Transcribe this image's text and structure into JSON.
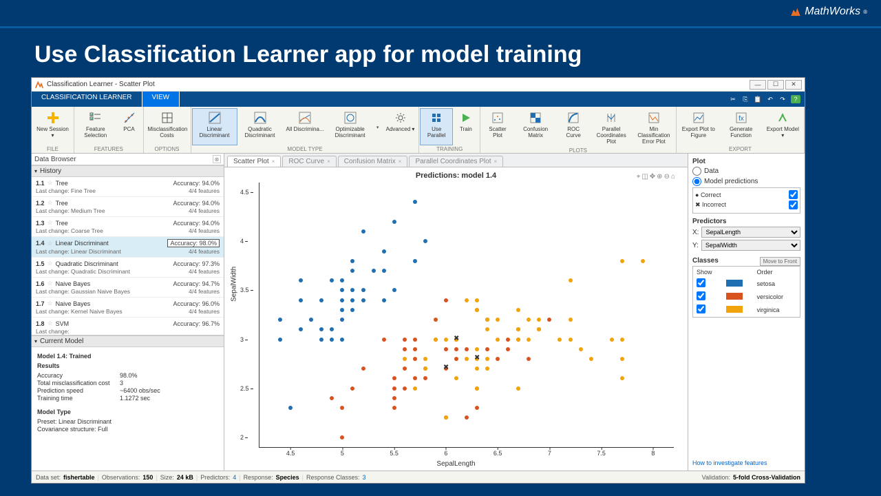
{
  "slide": {
    "brand": "MathWorks",
    "title": "Use Classification Learner app for model training"
  },
  "window": {
    "title": "Classification Learner - Scatter Plot"
  },
  "app_tabs": {
    "active": "CLASSIFICATION LEARNER",
    "other": "VIEW"
  },
  "toolstrip": {
    "file": {
      "label": "FILE",
      "btns": [
        {
          "k": "new",
          "l": "New Session ▾"
        }
      ]
    },
    "features": {
      "label": "FEATURES",
      "btns": [
        {
          "k": "fs",
          "l": "Feature Selection"
        },
        {
          "k": "pca",
          "l": "PCA"
        }
      ]
    },
    "options": {
      "label": "OPTIONS",
      "btns": [
        {
          "k": "mc",
          "l": "Misclassification Costs"
        }
      ]
    },
    "modeltype": {
      "label": "MODEL TYPE",
      "btns": [
        {
          "k": "ld",
          "l": "Linear Discriminant",
          "sel": true
        },
        {
          "k": "qd",
          "l": "Quadratic Discriminant"
        },
        {
          "k": "ad",
          "l": "All Discrimina..."
        },
        {
          "k": "od",
          "l": "Optimizable Discriminant"
        }
      ],
      "dd": true,
      "adv": {
        "k": "adv",
        "l": "Advanced ▾"
      }
    },
    "training": {
      "label": "TRAINING",
      "btns": [
        {
          "k": "up",
          "l": "Use Parallel",
          "sel": true
        },
        {
          "k": "tr",
          "l": "Train"
        }
      ]
    },
    "plots": {
      "label": "PLOTS",
      "btns": [
        {
          "k": "sp",
          "l": "Scatter Plot"
        },
        {
          "k": "cm",
          "l": "Confusion Matrix"
        },
        {
          "k": "rc",
          "l": "ROC Curve"
        },
        {
          "k": "pc",
          "l": "Parallel Coordinates Plot"
        },
        {
          "k": "mce",
          "l": "Min Classification Error Plot"
        }
      ]
    },
    "export": {
      "label": "EXPORT",
      "btns": [
        {
          "k": "ef",
          "l": "Export Plot to Figure"
        },
        {
          "k": "gf",
          "l": "Generate Function"
        },
        {
          "k": "em",
          "l": "Export Model ▾"
        }
      ]
    }
  },
  "data_browser": "Data Browser",
  "history": {
    "label": "History",
    "items": [
      {
        "id": "1.1",
        "name": "Tree",
        "acc": "94.0%",
        "feat": "4/4 features",
        "last": "Fine Tree"
      },
      {
        "id": "1.2",
        "name": "Tree",
        "acc": "94.0%",
        "feat": "4/4 features",
        "last": "Medium Tree"
      },
      {
        "id": "1.3",
        "name": "Tree",
        "acc": "94.0%",
        "feat": "4/4 features",
        "last": "Coarse Tree"
      },
      {
        "id": "1.4",
        "name": "Linear Discriminant",
        "acc": "98.0%",
        "feat": "4/4 features",
        "last": "Linear Discriminant",
        "active": true
      },
      {
        "id": "1.5",
        "name": "Quadratic Discriminant",
        "acc": "97.3%",
        "feat": "4/4 features",
        "last": "Quadratic Discriminant"
      },
      {
        "id": "1.6",
        "name": "Naive Bayes",
        "acc": "94.7%",
        "feat": "4/4 features",
        "last": "Gaussian Naive Bayes"
      },
      {
        "id": "1.7",
        "name": "Naive Bayes",
        "acc": "96.0%",
        "feat": "4/4 features",
        "last": "Kernel Naive Bayes"
      },
      {
        "id": "1.8",
        "name": "SVM",
        "acc": "96.7%",
        "feat": "",
        "last": ""
      }
    ],
    "acc_label": "Accuracy:",
    "last_label": "Last change:"
  },
  "current_model": {
    "label": "Current Model",
    "heading": "Model 1.4: Trained",
    "results_h": "Results",
    "rows": [
      {
        "k": "Accuracy",
        "v": "98.0%"
      },
      {
        "k": "Total misclassification cost",
        "v": "3"
      },
      {
        "k": "Prediction speed",
        "v": "~6400 obs/sec"
      },
      {
        "k": "Training time",
        "v": "1.1272 sec"
      }
    ],
    "mt_h": "Model Type",
    "mt_rows": [
      {
        "k": "Preset:",
        "v": "Linear Discriminant"
      },
      {
        "k": "Covariance structure:",
        "v": "Full"
      }
    ]
  },
  "doc_tabs": [
    "Scatter Plot",
    "ROC Curve",
    "Confusion Matrix",
    "Parallel Coordinates Plot"
  ],
  "plot": {
    "title": "Predictions: model 1.4",
    "xlabel": "SepalLength",
    "ylabel": "SepalWidth",
    "right": {
      "plot_h": "Plot",
      "data": "Data",
      "mp": "Model predictions",
      "correct": "Correct",
      "incorrect": "Incorrect",
      "pred_h": "Predictors",
      "x": "X:",
      "y": "Y:",
      "xsel": "SepalLength",
      "ysel": "SepalWidth",
      "cls_h": "Classes",
      "move": "Move to Front",
      "show": "Show",
      "order": "Order",
      "c1": "setosa",
      "c2": "versicolor",
      "c3": "virginica",
      "link": "How to investigate features"
    }
  },
  "status": {
    "dataset_k": "Data set:",
    "dataset_v": "fishertable",
    "obs_k": "Observations:",
    "obs_v": "150",
    "size_k": "Size:",
    "size_v": "24 kB",
    "pred_k": "Predictors:",
    "pred_v": "4",
    "resp_k": "Response:",
    "resp_v": "Species",
    "rc_k": "Response Classes:",
    "rc_v": "3",
    "val_k": "Validation:",
    "val_v": "5-fold Cross-Validation"
  },
  "chart_data": {
    "type": "scatter",
    "title": "Predictions: model 1.4",
    "xlabel": "SepalLength",
    "ylabel": "SepalWidth",
    "xlim": [
      4.2,
      8.2
    ],
    "ylim": [
      1.9,
      4.6
    ],
    "xticks": [
      4.5,
      5,
      5.5,
      6,
      6.5,
      7,
      7.5,
      8
    ],
    "yticks": [
      2,
      2.5,
      3,
      3.5,
      4,
      4.5
    ],
    "classes": [
      "setosa",
      "versicolor",
      "virginica"
    ],
    "colors": {
      "setosa": "#1f6fb2",
      "versicolor": "#d9531e",
      "virginica": "#f0a30a"
    },
    "series": [
      {
        "name": "setosa",
        "points": [
          [
            4.4,
            3.0
          ],
          [
            4.4,
            3.2
          ],
          [
            4.5,
            2.3
          ],
          [
            4.6,
            3.1
          ],
          [
            4.6,
            3.4
          ],
          [
            4.6,
            3.6
          ],
          [
            4.7,
            3.2
          ],
          [
            4.8,
            3.0
          ],
          [
            4.8,
            3.1
          ],
          [
            4.8,
            3.4
          ],
          [
            4.9,
            3.0
          ],
          [
            4.9,
            3.1
          ],
          [
            4.9,
            3.6
          ],
          [
            5.0,
            3.0
          ],
          [
            5.0,
            3.2
          ],
          [
            5.0,
            3.3
          ],
          [
            5.0,
            3.4
          ],
          [
            5.0,
            3.5
          ],
          [
            5.0,
            3.6
          ],
          [
            5.1,
            3.3
          ],
          [
            5.1,
            3.4
          ],
          [
            5.1,
            3.5
          ],
          [
            5.1,
            3.7
          ],
          [
            5.1,
            3.8
          ],
          [
            5.2,
            3.4
          ],
          [
            5.2,
            3.5
          ],
          [
            5.2,
            4.1
          ],
          [
            5.3,
            3.7
          ],
          [
            5.4,
            3.4
          ],
          [
            5.4,
            3.7
          ],
          [
            5.4,
            3.9
          ],
          [
            5.5,
            3.5
          ],
          [
            5.5,
            4.2
          ],
          [
            5.7,
            3.8
          ],
          [
            5.7,
            4.4
          ],
          [
            5.8,
            4.0
          ]
        ]
      },
      {
        "name": "versicolor",
        "points": [
          [
            4.9,
            2.4
          ],
          [
            5.0,
            2.0
          ],
          [
            5.0,
            2.3
          ],
          [
            5.1,
            2.5
          ],
          [
            5.2,
            2.7
          ],
          [
            5.4,
            3.0
          ],
          [
            5.5,
            2.3
          ],
          [
            5.5,
            2.4
          ],
          [
            5.5,
            2.5
          ],
          [
            5.5,
            2.6
          ],
          [
            5.6,
            2.5
          ],
          [
            5.6,
            2.7
          ],
          [
            5.6,
            2.9
          ],
          [
            5.6,
            3.0
          ],
          [
            5.7,
            2.6
          ],
          [
            5.7,
            2.8
          ],
          [
            5.7,
            2.9
          ],
          [
            5.7,
            3.0
          ],
          [
            5.8,
            2.6
          ],
          [
            5.8,
            2.7
          ],
          [
            5.9,
            3.0
          ],
          [
            5.9,
            3.2
          ],
          [
            6.0,
            2.2
          ],
          [
            6.0,
            2.7
          ],
          [
            6.0,
            2.9
          ],
          [
            6.0,
            3.4
          ],
          [
            6.1,
            2.8
          ],
          [
            6.1,
            2.9
          ],
          [
            6.1,
            3.0
          ],
          [
            6.2,
            2.2
          ],
          [
            6.2,
            2.9
          ],
          [
            6.3,
            2.3
          ],
          [
            6.3,
            2.5
          ],
          [
            6.3,
            3.3
          ],
          [
            6.4,
            2.9
          ],
          [
            6.4,
            3.2
          ],
          [
            6.5,
            2.8
          ],
          [
            6.6,
            2.9
          ],
          [
            6.6,
            3.0
          ],
          [
            6.7,
            3.0
          ],
          [
            6.7,
            3.1
          ],
          [
            6.8,
            2.8
          ],
          [
            6.9,
            3.1
          ],
          [
            7.0,
            3.2
          ]
        ]
      },
      {
        "name": "virginica",
        "points": [
          [
            5.6,
            2.8
          ],
          [
            5.7,
            2.5
          ],
          [
            5.8,
            2.7
          ],
          [
            5.8,
            2.8
          ],
          [
            5.9,
            3.0
          ],
          [
            6.0,
            2.2
          ],
          [
            6.0,
            3.0
          ],
          [
            6.1,
            2.6
          ],
          [
            6.1,
            3.0
          ],
          [
            6.2,
            2.8
          ],
          [
            6.2,
            3.4
          ],
          [
            6.3,
            2.5
          ],
          [
            6.3,
            2.7
          ],
          [
            6.3,
            2.8
          ],
          [
            6.3,
            2.9
          ],
          [
            6.3,
            3.3
          ],
          [
            6.3,
            3.4
          ],
          [
            6.4,
            2.7
          ],
          [
            6.4,
            2.8
          ],
          [
            6.4,
            3.1
          ],
          [
            6.4,
            3.2
          ],
          [
            6.5,
            3.0
          ],
          [
            6.5,
            3.2
          ],
          [
            6.7,
            2.5
          ],
          [
            6.7,
            3.0
          ],
          [
            6.7,
            3.1
          ],
          [
            6.7,
            3.3
          ],
          [
            6.8,
            3.0
          ],
          [
            6.8,
            3.2
          ],
          [
            6.9,
            3.1
          ],
          [
            6.9,
            3.2
          ],
          [
            7.1,
            3.0
          ],
          [
            7.2,
            3.0
          ],
          [
            7.2,
            3.2
          ],
          [
            7.2,
            3.6
          ],
          [
            7.3,
            2.9
          ],
          [
            7.4,
            2.8
          ],
          [
            7.6,
            3.0
          ],
          [
            7.7,
            2.6
          ],
          [
            7.7,
            2.8
          ],
          [
            7.7,
            3.0
          ],
          [
            7.7,
            3.8
          ],
          [
            7.9,
            3.8
          ]
        ]
      }
    ],
    "incorrect": [
      [
        6.1,
        3.0
      ],
      [
        6.3,
        2.8
      ],
      [
        6.0,
        2.7
      ]
    ]
  }
}
